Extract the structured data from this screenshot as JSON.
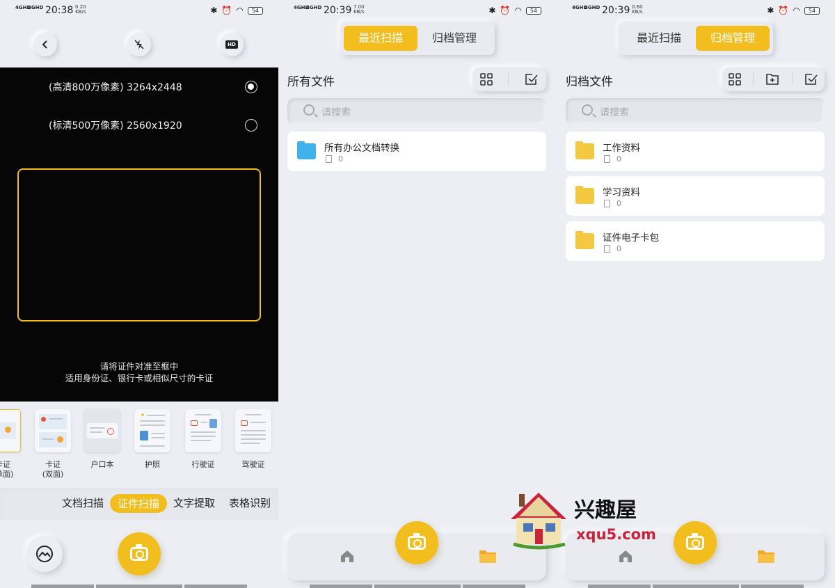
{
  "screens": [
    {
      "status": {
        "net1": "4GHD",
        "net2": "4GHD",
        "time": "20:38",
        "speed_value": "0.20",
        "speed_unit": "KB/s",
        "battery": "54"
      },
      "top_buttons": {
        "hd": "HD"
      },
      "resolutions": [
        {
          "label": "(高清800万像素) 3264x2448",
          "selected": true
        },
        {
          "label": "(标清500万像素) 2560x1920",
          "selected": false
        }
      ],
      "hint_line1": "请将证件对准至框中",
      "hint_line2": "适用身份证、银行卡或相似尺寸的卡证",
      "card_types": [
        {
          "line1": "卡证",
          "line2": "(单面)"
        },
        {
          "line1": "卡证",
          "line2": "(双面)"
        },
        {
          "line1": "户口本",
          "line2": ""
        },
        {
          "line1": "护照",
          "line2": ""
        },
        {
          "line1": "行驶证",
          "line2": ""
        },
        {
          "line1": "驾驶证",
          "line2": ""
        }
      ],
      "modes": [
        "文档扫描",
        "证件扫描",
        "文字提取",
        "表格识别"
      ],
      "active_mode": "证件扫描"
    },
    {
      "status": {
        "net1": "4GHD",
        "net2": "4GHD",
        "time": "20:39",
        "speed_value": "7.00",
        "speed_unit": "KB/s",
        "battery": "54"
      },
      "tabs": [
        "最近扫描",
        "归档管理"
      ],
      "active_tab": "最近扫描",
      "section_title": "所有文件",
      "search_placeholder": "请搜索",
      "folders": [
        {
          "name": "所有办公文档转换",
          "count": "0",
          "color": "#3fb2ec"
        }
      ]
    },
    {
      "status": {
        "net1": "4GHD",
        "net2": "4GHD",
        "time": "20:39",
        "speed_value": "0.60",
        "speed_unit": "KB/s",
        "battery": "54"
      },
      "tabs": [
        "最近扫描",
        "归档管理"
      ],
      "active_tab": "归档管理",
      "section_title": "归档文件",
      "search_placeholder": "请搜索",
      "folders": [
        {
          "name": "工作资料",
          "count": "0",
          "color": "#f5c842"
        },
        {
          "name": "学习资料",
          "count": "0",
          "color": "#f5c842"
        },
        {
          "name": "证件电子卡包",
          "count": "0",
          "color": "#f5c842"
        }
      ]
    }
  ],
  "watermark": {
    "brand": "兴趣屋",
    "url": "xqu5.com"
  },
  "colors": {
    "accent": "#f2be1d",
    "background": "#eceef4",
    "viewfinder": "#060606"
  }
}
